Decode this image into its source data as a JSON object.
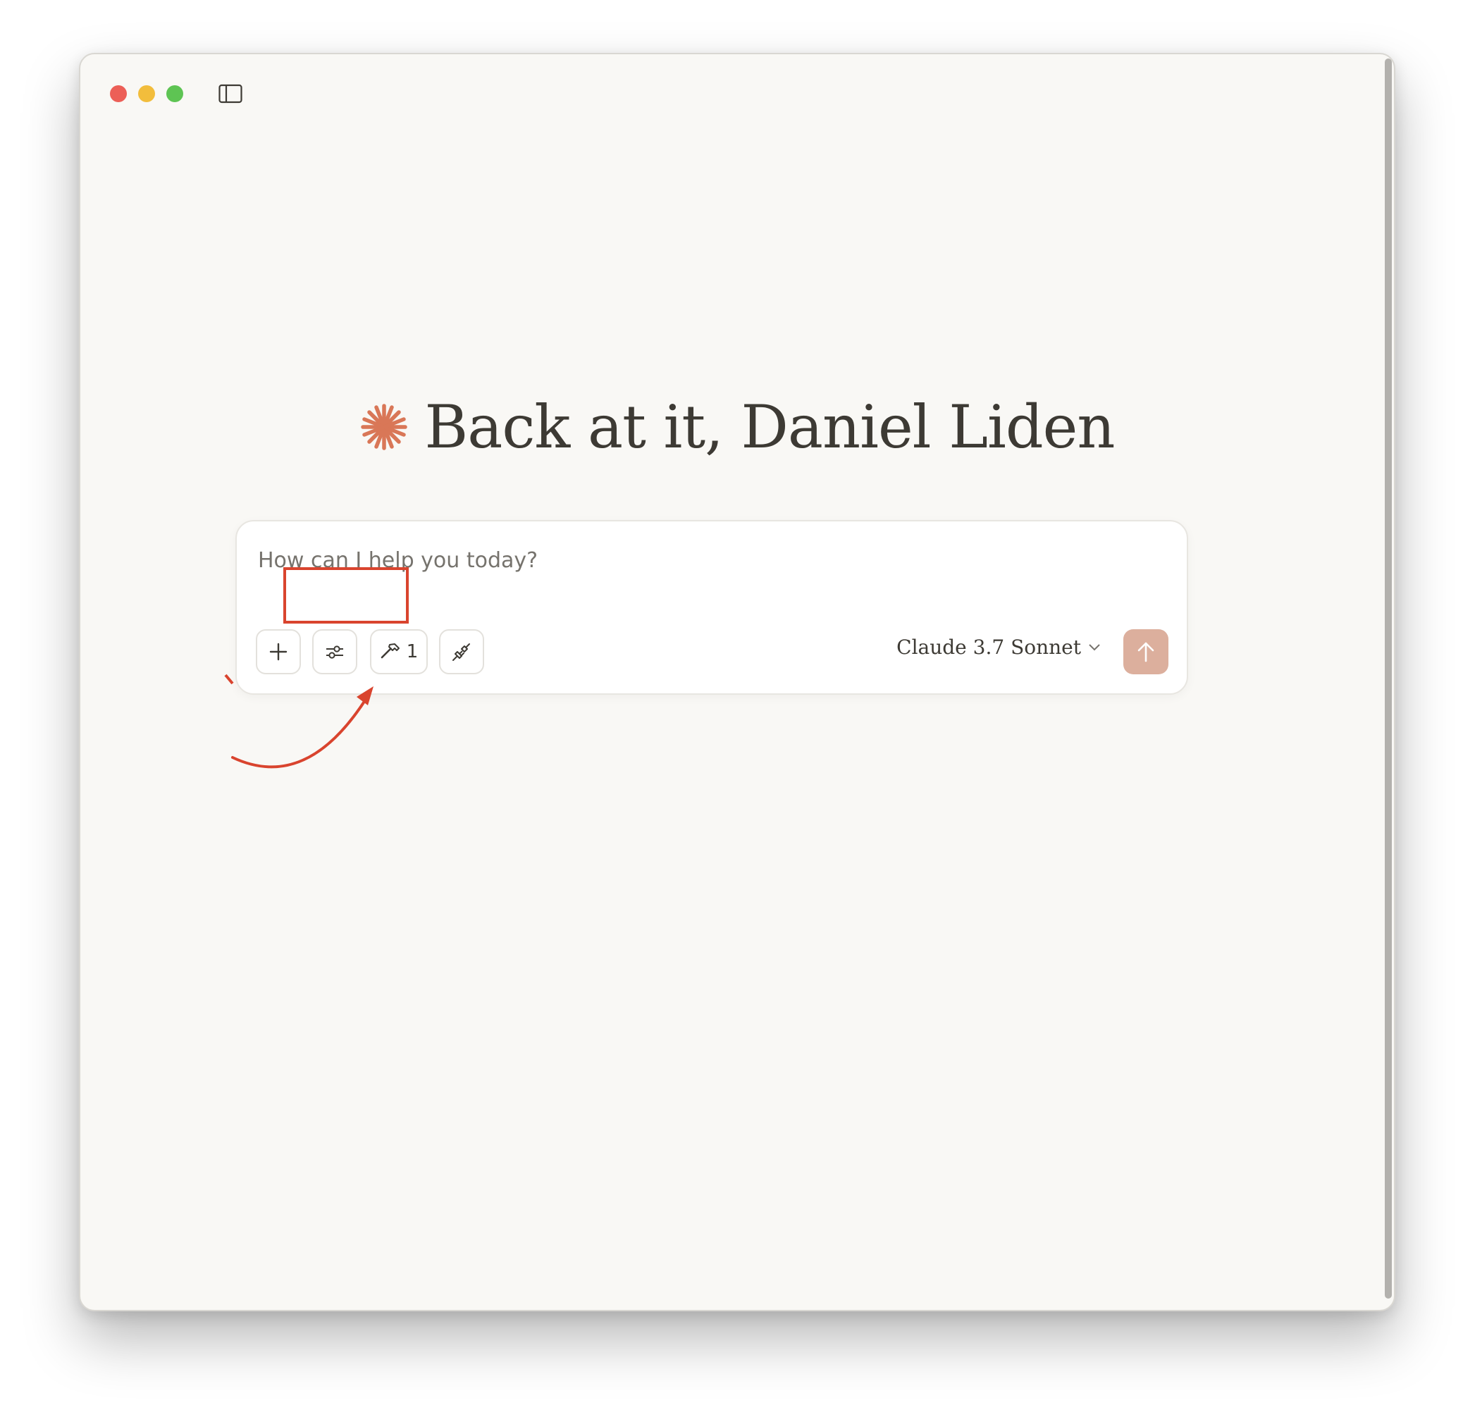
{
  "window": {
    "controls": [
      "close",
      "minimize",
      "zoom"
    ],
    "sidebar_toggle_icon": "sidebar-icon"
  },
  "greeting": {
    "icon": "claude-spark-icon",
    "text": "Back at it, Daniel Liden",
    "icon_color": "#d97757"
  },
  "composer": {
    "placeholder": "How can I help you today?",
    "value": "",
    "buttons": {
      "add_icon": "plus-icon",
      "settings_icon": "sliders-icon",
      "tools_icon": "hammer-icon",
      "tools_count": "1",
      "integrations_icon": "plug-icon"
    },
    "model": {
      "name": "Claude 3.7 Sonnet",
      "icon": "chevron-down-icon"
    },
    "send": {
      "icon": "arrow-up-icon",
      "color": "#dcaf9d"
    }
  },
  "annotation": {
    "color": "#d9442e",
    "shapes": [
      "highlight-box",
      "curved-arrow"
    ]
  }
}
